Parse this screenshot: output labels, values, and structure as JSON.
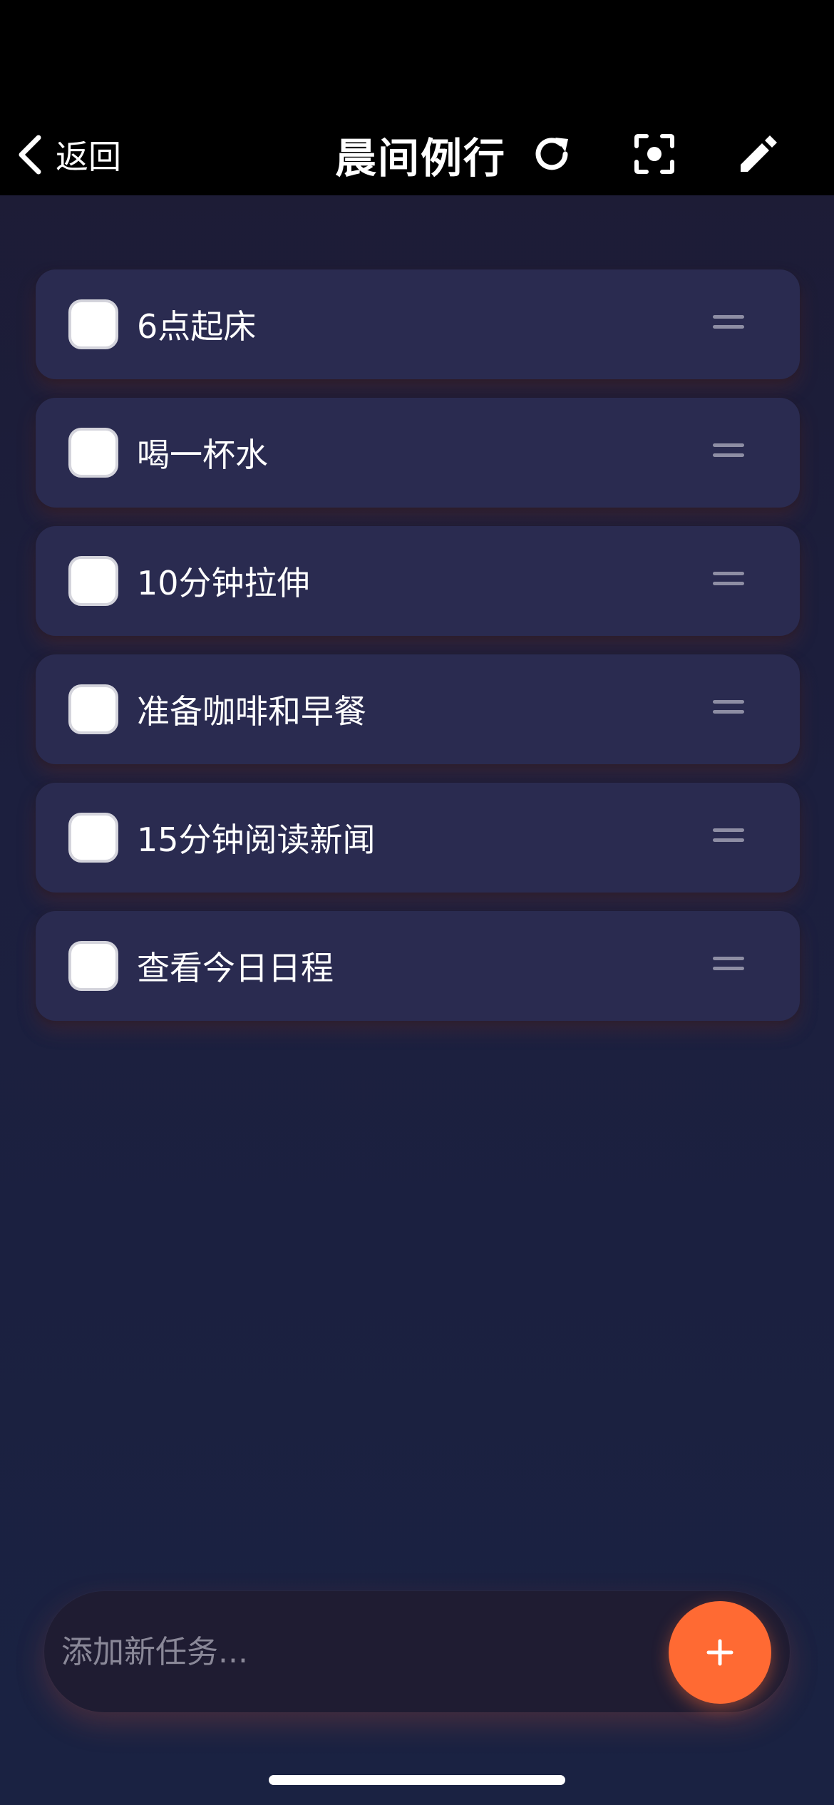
{
  "nav": {
    "back_label": "返回",
    "title": "晨间例行",
    "icons": [
      "refresh-icon",
      "focus-icon",
      "edit-icon"
    ]
  },
  "tasks": [
    {
      "label": "6点起床",
      "checked": false
    },
    {
      "label": "喝一杯水",
      "checked": false
    },
    {
      "label": "10分钟拉伸",
      "checked": false
    },
    {
      "label": "准备咖啡和早餐",
      "checked": false
    },
    {
      "label": "15分钟阅读新闻",
      "checked": false
    },
    {
      "label": "查看今日日程",
      "checked": false
    }
  ],
  "add_task": {
    "placeholder": "添加新任务...",
    "button_icon": "plus-icon"
  },
  "colors": {
    "accent": "#ff6a33",
    "card": "#2a2b50",
    "background": "#1c1f3e"
  }
}
